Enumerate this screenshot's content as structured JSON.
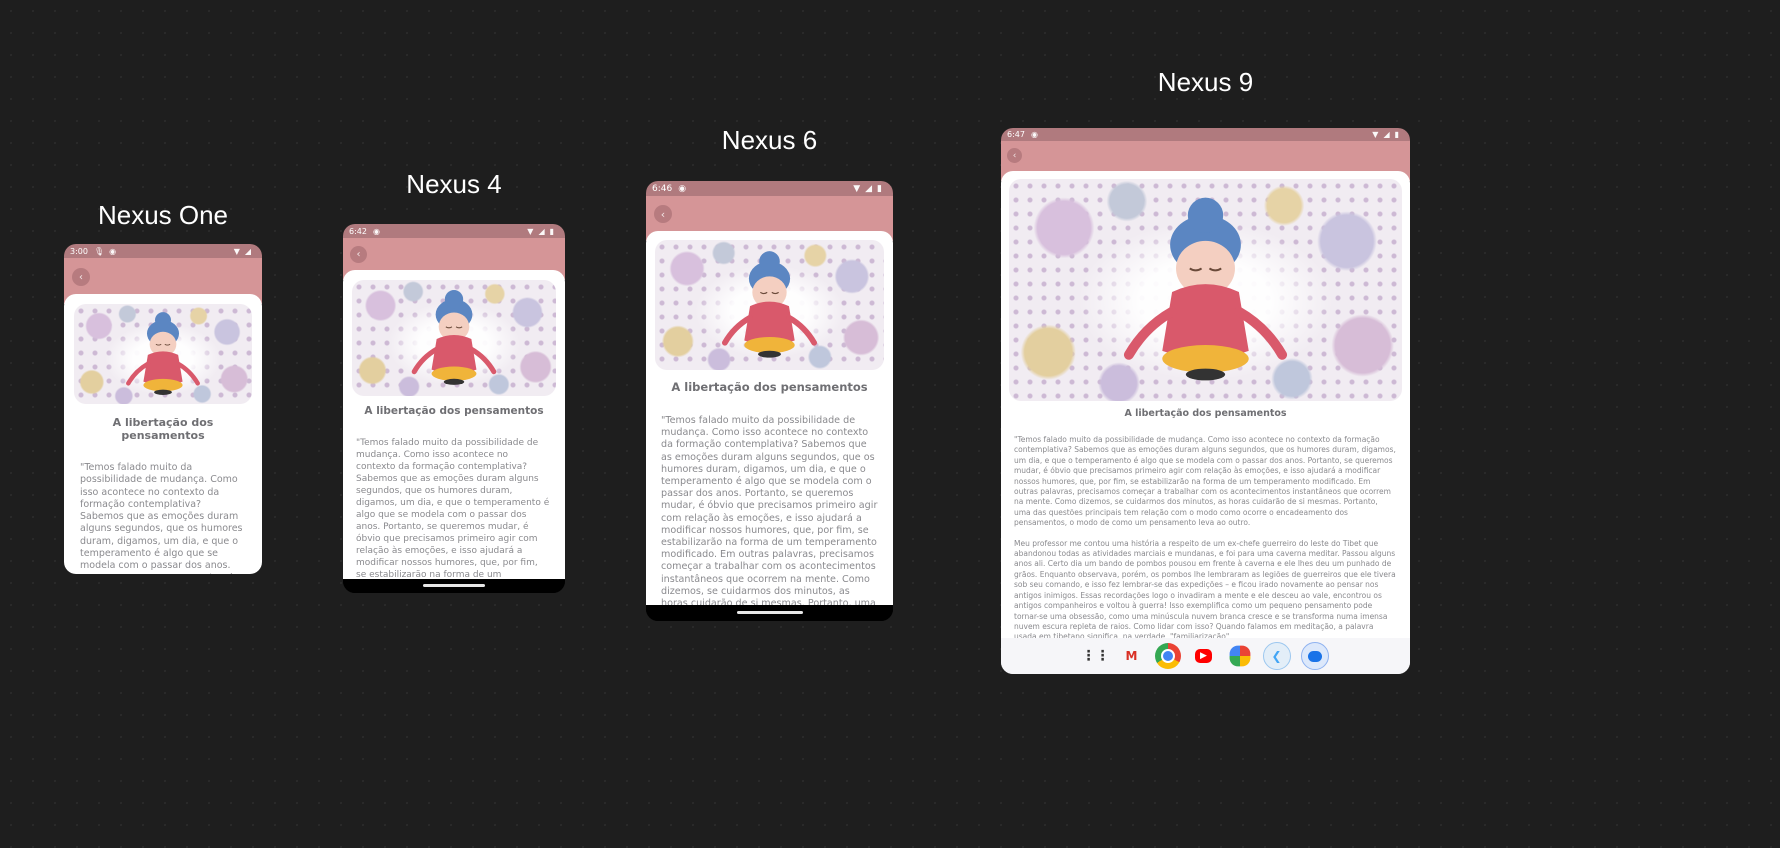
{
  "article": {
    "title": "A libertação dos pensamentos",
    "paragraph1": "\"Temos falado muito da possibilidade de mudança. Como isso acontece no contexto da formação contemplativa? Sabemos que as emoções duram alguns segundos, que os humores duram, digamos, um dia, e que o temperamento é algo que se modela com o passar dos anos. Portanto, se queremos mudar, é óbvio que precisamos primeiro agir com relação às emoções, e isso ajudará a modificar nossos humores, que, por fim, se estabilizarão na forma de um temperamento modificado. Em outras palavras, precisamos começar a trabalhar com os acontecimentos instantâneos que ocorrem na mente. Como dizemos, se cuidarmos dos minutos, as horas cuidarão de si mesmas. Portanto, uma das questões principais tem relação com o modo como ocorre o encadeamento dos pensamentos, o modo de como um pensamento leva ao outro.",
    "paragraph2": "Meu professor me contou uma história a respeito de um ex-chefe guerreiro do leste do Tibet que abandonou todas as atividades marciais e mundanas, e foi para uma caverna meditar. Passou alguns anos ali. Certo dia um bando de pombos pousou em frente à caverna e ele lhes deu um punhado de grãos. Enquanto observava, porém, os pombos lhe lembraram as legiões de guerreiros que ele tivera sob seu comando, e isso fez lembrar-se das expedições – e ficou irado novamente ao pensar nos antigos inimigos. Essas recordações logo o invadiram a mente e ele desceu ao vale, encontrou os antigos companheiros e voltou à guerra! Isso exemplifica como um pequeno pensamento pode tornar-se uma obsessão, como uma minúscula nuvem branca cresce e se transforma numa imensa nuvem escura repleta de raios. Como lidar com isso? Quando falamos em meditação, a palavra usada em tibetano significa, na verdade, \"familiarização\"."
  },
  "devices": [
    {
      "name": "Nexus One",
      "time": "3:00",
      "status_icons": [
        "mic-icon",
        "app-icon"
      ]
    },
    {
      "name": "Nexus 4",
      "time": "6:42",
      "status_icons": [
        "app-icon"
      ]
    },
    {
      "name": "Nexus 6",
      "time": "6:46",
      "status_icons": [
        "app-icon"
      ]
    },
    {
      "name": "Nexus 9",
      "time": "6:47",
      "status_icons": [
        "app-icon"
      ]
    }
  ],
  "dock_apps": [
    "apps-grid-icon",
    "gmail-icon",
    "chrome-icon",
    "youtube-icon",
    "photos-icon",
    "flutter-icon",
    "messages-icon"
  ],
  "colors": {
    "background": "#1e1e1e",
    "status_bar": "#b07a7e",
    "app_bar": "#d59597",
    "back_button": "#b77b7f",
    "title_text": "#6f6f73",
    "body_text": "#8a8a8e"
  }
}
